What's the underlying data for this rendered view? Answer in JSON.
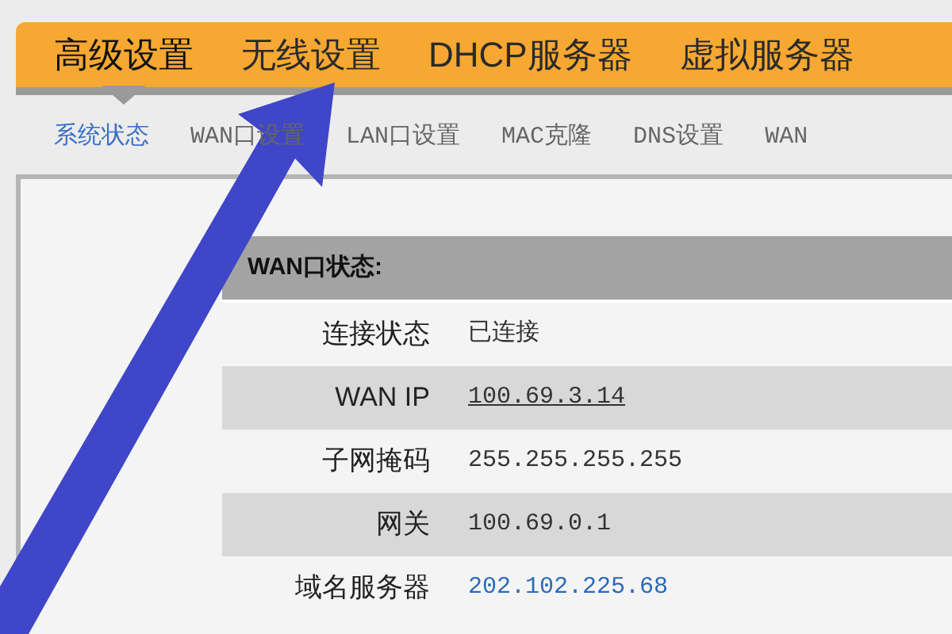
{
  "main_tabs": [
    {
      "label": "高级设置",
      "selected": true
    },
    {
      "label": "无线设置",
      "selected": false
    },
    {
      "label": "DHCP服务器",
      "selected": false
    },
    {
      "label": "虚拟服务器",
      "selected": false
    }
  ],
  "sub_tabs": [
    {
      "label": "系统状态",
      "selected": true
    },
    {
      "label": "WAN口设置",
      "selected": false
    },
    {
      "label": "LAN口设置",
      "selected": false
    },
    {
      "label": "MAC克隆",
      "selected": false
    },
    {
      "label": "DNS设置",
      "selected": false
    },
    {
      "label": "WAN",
      "selected": false
    }
  ],
  "section": {
    "title": "WAN口状态:",
    "rows": [
      {
        "label": "连接状态",
        "value": "已连接",
        "kind": "plain"
      },
      {
        "label": "WAN IP",
        "value": "100.69.3.14",
        "kind": "link"
      },
      {
        "label": "子网掩码",
        "value": "255.255.255.255",
        "kind": "plain"
      },
      {
        "label": "网关",
        "value": "100.69.0.1",
        "kind": "plain"
      },
      {
        "label": "域名服务器",
        "value": "202.102.225.68",
        "kind": "server"
      }
    ]
  }
}
